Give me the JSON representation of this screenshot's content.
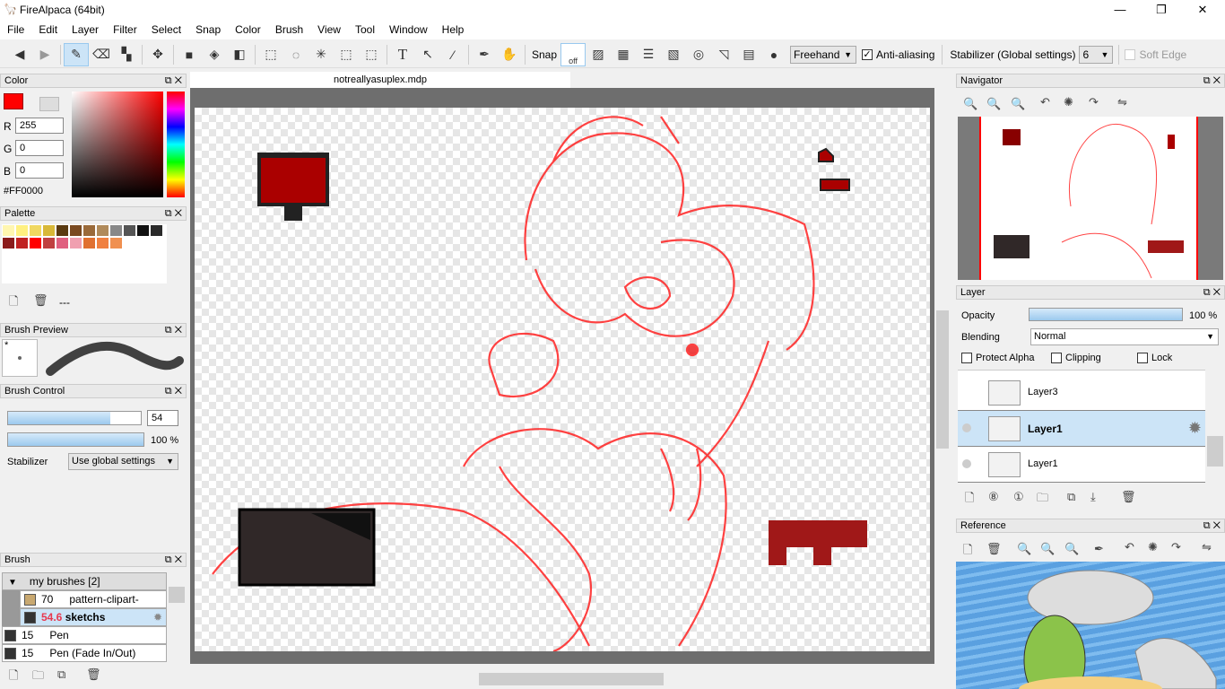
{
  "app": {
    "title": "FireAlpaca (64bit)",
    "minimize": "—",
    "maximize": "❐",
    "close": "✕"
  },
  "menu": [
    "File",
    "Edit",
    "Layer",
    "Filter",
    "Select",
    "Snap",
    "Color",
    "Brush",
    "View",
    "Tool",
    "Window",
    "Help"
  ],
  "toolbar": {
    "snap_label": "Snap",
    "snap_off": "off",
    "mode": "Freehand",
    "antialias_label": "Anti-aliasing",
    "antialias_checked": true,
    "stabilizer_label": "Stabilizer (Global settings)",
    "stabilizer_value": "6",
    "soft_edge_label": "Soft Edge"
  },
  "document": {
    "tab": "notreallyasuplex.mdp"
  },
  "color": {
    "title": "Color",
    "r_label": "R",
    "r": "255",
    "g_label": "G",
    "g": "0",
    "b_label": "B",
    "b": "0",
    "hex": "#FF0000",
    "primary": "#ff0000"
  },
  "palette": {
    "title": "Palette",
    "dash": "---",
    "colors": [
      "#fff6b0",
      "#fff080",
      "#f0d860",
      "#d8b838",
      "#5a3a10",
      "#7a4a20",
      "#9a6a3a",
      "#b08a5a",
      "#888888",
      "#555555",
      "#111111",
      "#2a2a2a",
      "#8a1a1a",
      "#c02020",
      "#ff0000",
      "#c04040",
      "#e06080",
      "#f0a0b0",
      "#e07030",
      "#f08040",
      "#f09050"
    ]
  },
  "brush_preview": {
    "title": "Brush Preview",
    "marker": "*"
  },
  "brush_control": {
    "title": "Brush Control",
    "size": "54",
    "size_fraction": 0.77,
    "opacity": "100 %",
    "opacity_fraction": 1.0,
    "stabilizer_label": "Stabilizer",
    "stabilizer_value": "Use global settings"
  },
  "brush": {
    "title": "Brush",
    "group": "my brushes [2]",
    "items": [
      {
        "size": "70",
        "name": "pattern-clipart-basic-",
        "swatch": "#c8a870"
      },
      {
        "size": "54.6",
        "name": "sketchs",
        "swatch": "#333333",
        "selected": true
      },
      {
        "size": "15",
        "name": "Pen",
        "swatch": "#333333"
      },
      {
        "size": "15",
        "name": "Pen (Fade In/Out)",
        "swatch": "#333333"
      }
    ]
  },
  "navigator": {
    "title": "Navigator"
  },
  "layer": {
    "title": "Layer",
    "opacity_label": "Opacity",
    "opacity": "100 %",
    "blending_label": "Blending",
    "blending": "Normal",
    "protect_alpha": "Protect Alpha",
    "clipping": "Clipping",
    "lock": "Lock",
    "layers": [
      {
        "name": "Layer3"
      },
      {
        "name": "Layer1",
        "selected": true
      },
      {
        "name": "Layer1"
      }
    ]
  },
  "reference": {
    "title": "Reference"
  },
  "accent": "#cce4f7"
}
